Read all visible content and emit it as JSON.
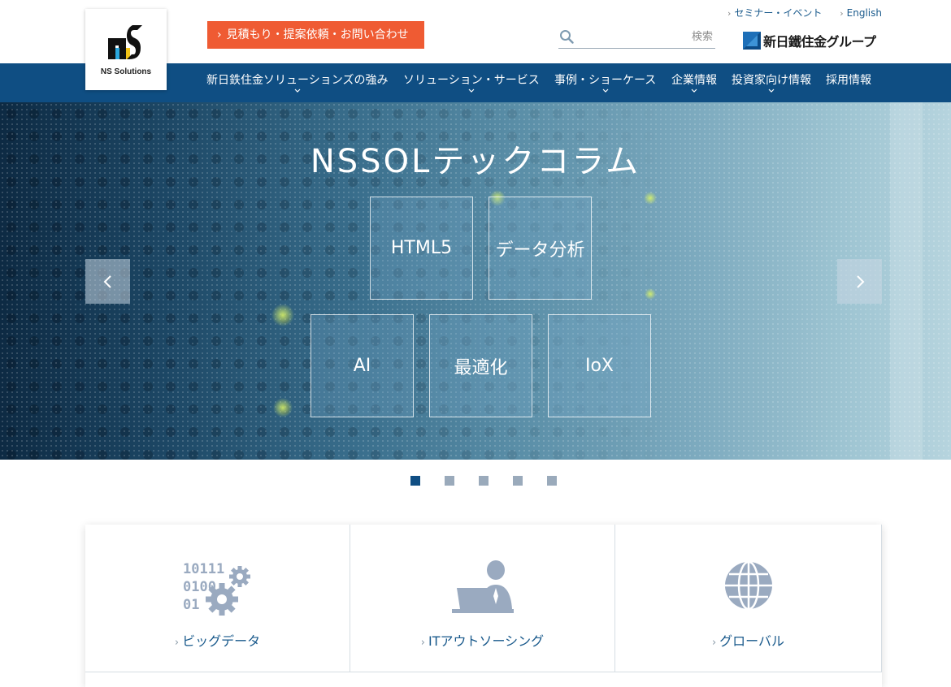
{
  "brand": {
    "logo_text": "NS Solutions",
    "group_text": "新日鐵住金グループ"
  },
  "header": {
    "cta_label": "見積もり・提案依頼・お問い合わせ",
    "util_links": [
      "セミナー・イベント",
      "English"
    ],
    "search_placeholder": "検索"
  },
  "nav": {
    "items": [
      {
        "label": "新日鉄住金ソリューションズの強み",
        "has_dropdown": true
      },
      {
        "label": "ソリューション・サービス",
        "has_dropdown": true
      },
      {
        "label": "事例・ショーケース",
        "has_dropdown": true
      },
      {
        "label": "企業情報",
        "has_dropdown": true
      },
      {
        "label": "投資家向け情報",
        "has_dropdown": true
      },
      {
        "label": "採用情報",
        "has_dropdown": false
      }
    ]
  },
  "hero": {
    "title": "NSSOLテックコラム",
    "tiles": [
      "HTML5",
      "データ分析",
      "AI",
      "最適化",
      "IoX"
    ],
    "prev_icon": "chevron-left-icon",
    "next_icon": "chevron-right-icon"
  },
  "pagination": {
    "total": 5,
    "active": 1
  },
  "services": [
    {
      "label": "ビッグデータ",
      "icon": "binary-gears-icon"
    },
    {
      "label": "ITアウトソーシング",
      "icon": "person-laptop-icon"
    },
    {
      "label": "グローバル",
      "icon": "globe-icon"
    }
  ],
  "colors": {
    "nav_bg": "#0f4e83",
    "cta_bg": "#ef5b33",
    "link": "#1a5a8c",
    "icon_gray": "#9aaac0"
  }
}
